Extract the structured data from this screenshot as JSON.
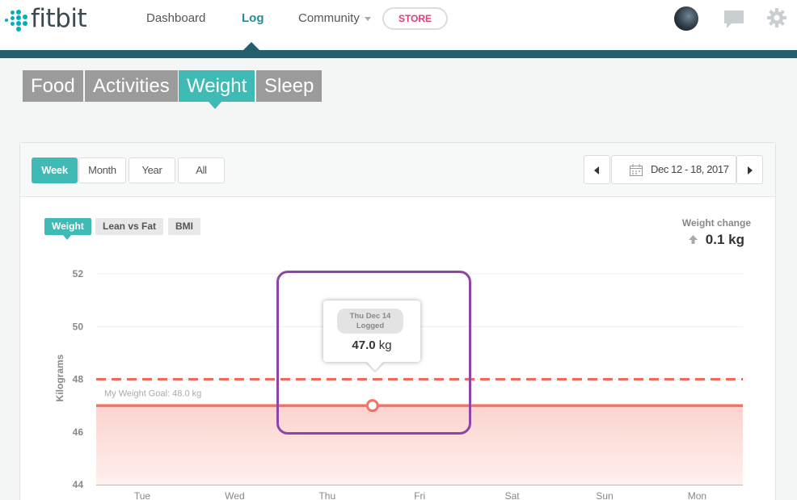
{
  "header": {
    "logo_text": "fitbit",
    "nav": {
      "dashboard": "Dashboard",
      "log": "Log",
      "community": "Community",
      "store": "STORE"
    }
  },
  "categories": [
    "Food",
    "Activities",
    "Weight",
    "Sleep"
  ],
  "active_category": "Weight",
  "ranges": [
    "Week",
    "Month",
    "Year",
    "All"
  ],
  "active_range": "Week",
  "date_range": "Dec 12 - 18, 2017",
  "sub_tabs": [
    "Weight",
    "Lean vs Fat",
    "BMI"
  ],
  "weight_change": {
    "label": "Weight change",
    "value": "0.1 kg"
  },
  "tooltip": {
    "date_line": "Thu Dec 14",
    "status": "Logged",
    "value": "47.0",
    "unit": "kg"
  },
  "chart_data": {
    "type": "area",
    "ylabel": "Kilograms",
    "ylim": [
      44,
      52
    ],
    "y_ticks": [
      "52",
      "50",
      "48",
      "46",
      "44"
    ],
    "categories": [
      "Tue",
      "Wed",
      "Thu",
      "Fri",
      "Sat",
      "Sun",
      "Mon"
    ],
    "series": [
      {
        "values": [
          47.0,
          47.0,
          47.0,
          47.0,
          47.0,
          47.0,
          47.0
        ],
        "color": "#f47263"
      }
    ],
    "goal": {
      "value": 48.0,
      "label": "My Weight Goal: 48.0 kg",
      "color": "#f0695a"
    },
    "highlight_point": {
      "x": "Thu",
      "y": 47.0
    },
    "grid": true
  },
  "colors": {
    "teal": "#3fbab4",
    "dark_teal": "#245f6e",
    "store_pink": "#e5397a",
    "highlight": "#8e44a8"
  }
}
